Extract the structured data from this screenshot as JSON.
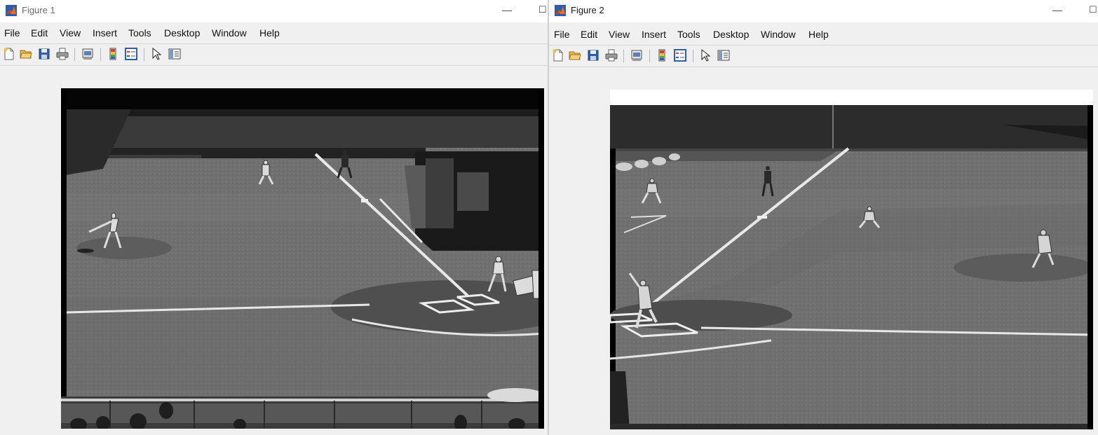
{
  "figure1": {
    "title": "Figure 1",
    "minimize": "—",
    "maximize": "☐",
    "menu": [
      "File",
      "Edit",
      "View",
      "Insert",
      "Tools",
      "Desktop",
      "Window",
      "Help"
    ],
    "toolbar": [
      "new-figure-icon",
      "open-file-icon",
      "save-icon",
      "print-icon",
      "print-preview-icon",
      "colorbar-icon",
      "legend-icon",
      "pointer-icon",
      "property-inspector-icon"
    ],
    "image_description": "Grayscale broadcast frame of a baseball game viewed from behind the first-base dugout roof"
  },
  "figure2": {
    "title": "Figure 2",
    "minimize": "—",
    "maximize": "☐",
    "menu": [
      "File",
      "Edit",
      "View",
      "Insert",
      "Tools",
      "Desktop",
      "Window",
      "Help"
    ],
    "toolbar": [
      "new-figure-icon",
      "open-file-icon",
      "save-icon",
      "print-icon",
      "print-preview-icon",
      "colorbar-icon",
      "legend-icon",
      "pointer-icon",
      "property-inspector-icon"
    ],
    "image_description": "Grayscale broadcast frame of a baseball game, horizontally mirrored view"
  },
  "colors": {
    "window_bg": "#f0f0f0",
    "matlab_icon_orange": "#e8702a",
    "matlab_icon_blue": "#2c5ea8",
    "grass": "#6f6f6f",
    "infield_dirt": "#5a5a5a",
    "roof": "#2a2a2a"
  }
}
